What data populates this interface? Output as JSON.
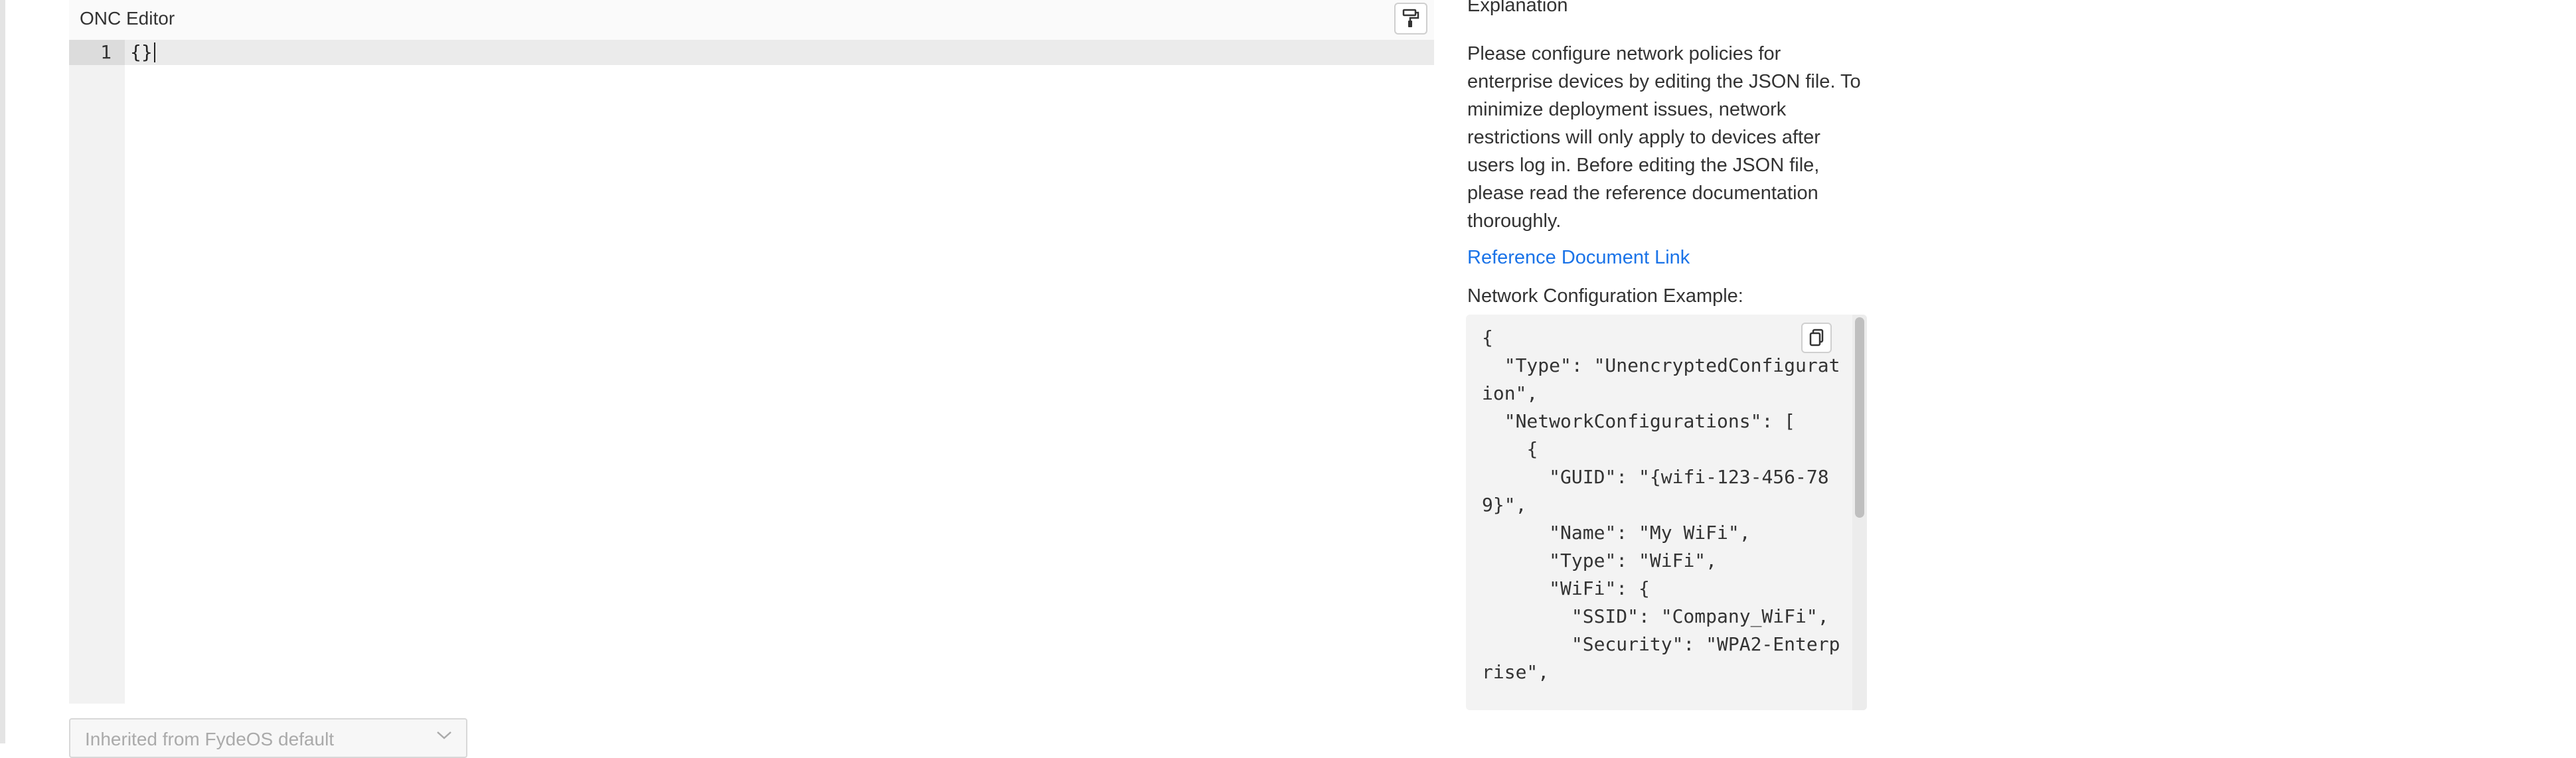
{
  "editor": {
    "title": "ONC Editor",
    "format_icon": "paint-roller-icon",
    "line_number": "1",
    "content": "{}"
  },
  "policy_select": {
    "selected": "Inherited from FydeOS default",
    "icon": "chevron-down-icon"
  },
  "explanation": {
    "title": "Explanation",
    "body": "Please configure network policies for enterprise devices by editing the JSON file. To minimize deployment issues, network restrictions will only apply to devices after users log in. Before editing the JSON file, please read the reference documentation thoroughly.",
    "link_text": "Reference Document Link",
    "example_label": "Network Configuration Example:",
    "copy_icon": "copy-icon",
    "example_code": "{\n  \"Type\": \"UnencryptedConfiguration\",\n  \"NetworkConfigurations\": [\n    {\n      \"GUID\": \"{wifi-123-456-789}\",\n      \"Name\": \"My WiFi\",\n      \"Type\": \"WiFi\",\n      \"WiFi\": {\n        \"SSID\": \"Company_WiFi\",\n        \"Security\": \"WPA2-Enterprise\","
  }
}
